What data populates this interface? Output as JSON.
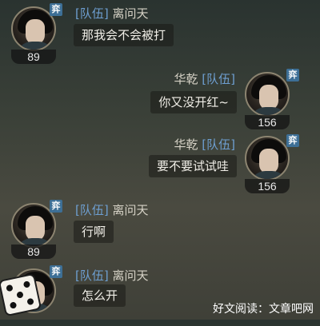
{
  "messages": [
    {
      "side": "left",
      "team_tag": "[队伍]",
      "name": "离问天",
      "text": "那我会不会被打",
      "level": "89",
      "badge": "弈"
    },
    {
      "side": "right",
      "team_tag": "[队伍]",
      "name": "华乾",
      "text": "你又没开红~",
      "level": "156",
      "badge": "弈"
    },
    {
      "side": "right",
      "team_tag": "[队伍]",
      "name": "华乾",
      "text": "要不要试试哇",
      "level": "156",
      "badge": "弈"
    },
    {
      "side": "left",
      "team_tag": "[队伍]",
      "name": "离问天",
      "text": "行啊",
      "level": "89",
      "badge": "弈"
    },
    {
      "side": "left",
      "team_tag": "[队伍]",
      "name": "离问天",
      "text": "怎么开",
      "level": "",
      "badge": "弈"
    }
  ],
  "watermark": "好文阅读：文章吧网",
  "icons": {
    "dice": "dice-icon"
  },
  "colors": {
    "team_tag": "#6e9fd1",
    "badge": "#3d6f96",
    "bubble_text": "#f1efe8"
  }
}
